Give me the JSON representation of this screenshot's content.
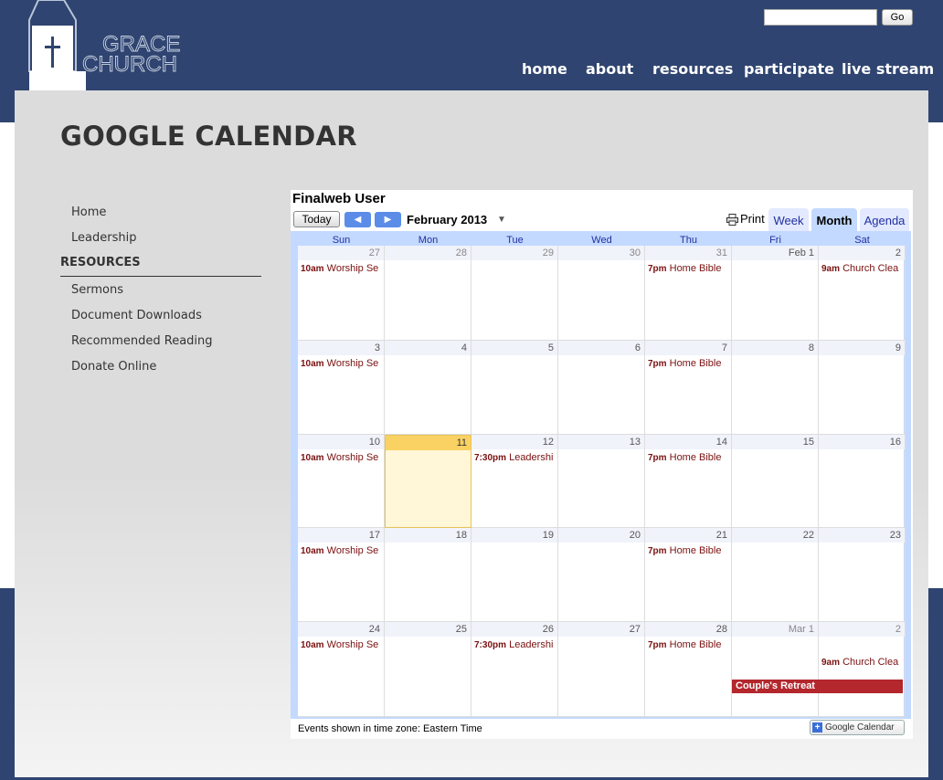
{
  "header": {
    "logo_text_line1": "GRACE",
    "logo_text_line2": "CHURCH",
    "search_placeholder": "",
    "go_label": "Go",
    "nav": [
      "home",
      "about",
      "resources",
      "participate",
      "live stream"
    ]
  },
  "page": {
    "title": "GOOGLE CALENDAR"
  },
  "sidebar": {
    "links_top": [
      "Home",
      "Leadership"
    ],
    "section_heading": "RESOURCES",
    "links": [
      "Sermons",
      "Document Downloads",
      "Recommended Reading",
      "Donate Online"
    ]
  },
  "calendar": {
    "owner": "Finalweb User",
    "today_label": "Today",
    "prev_icon": "◀",
    "next_icon": "▶",
    "month_label": "February 2013",
    "month_caret": "▼",
    "print_label": "Print",
    "tabs": [
      "Week",
      "Month",
      "Agenda"
    ],
    "active_tab": "Month",
    "days_of_week": [
      "Sun",
      "Mon",
      "Tue",
      "Wed",
      "Thu",
      "Fri",
      "Sat"
    ],
    "weeks": [
      [
        {
          "label": "27",
          "other": true,
          "events": [
            {
              "time": "10am",
              "title": "Worship Se"
            }
          ]
        },
        {
          "label": "28",
          "other": true,
          "events": []
        },
        {
          "label": "29",
          "other": true,
          "events": []
        },
        {
          "label": "30",
          "other": true,
          "events": []
        },
        {
          "label": "31",
          "other": true,
          "events": [
            {
              "time": "7pm",
              "title": "Home Bible"
            }
          ]
        },
        {
          "label": "Feb 1",
          "other": false,
          "events": []
        },
        {
          "label": "2",
          "other": false,
          "events": [
            {
              "time": "9am",
              "title": "Church Clea"
            }
          ]
        }
      ],
      [
        {
          "label": "3",
          "other": false,
          "events": [
            {
              "time": "10am",
              "title": "Worship Se"
            }
          ]
        },
        {
          "label": "4",
          "other": false,
          "events": []
        },
        {
          "label": "5",
          "other": false,
          "events": []
        },
        {
          "label": "6",
          "other": false,
          "events": []
        },
        {
          "label": "7",
          "other": false,
          "events": [
            {
              "time": "7pm",
              "title": "Home Bible"
            }
          ]
        },
        {
          "label": "8",
          "other": false,
          "events": []
        },
        {
          "label": "9",
          "other": false,
          "events": []
        }
      ],
      [
        {
          "label": "10",
          "other": false,
          "events": [
            {
              "time": "10am",
              "title": "Worship Se"
            }
          ]
        },
        {
          "label": "11",
          "other": false,
          "today": true,
          "events": []
        },
        {
          "label": "12",
          "other": false,
          "events": [
            {
              "time": "7:30pm",
              "title": "Leadershi"
            }
          ]
        },
        {
          "label": "13",
          "other": false,
          "events": []
        },
        {
          "label": "14",
          "other": false,
          "events": [
            {
              "time": "7pm",
              "title": "Home Bible"
            }
          ]
        },
        {
          "label": "15",
          "other": false,
          "events": []
        },
        {
          "label": "16",
          "other": false,
          "events": []
        }
      ],
      [
        {
          "label": "17",
          "other": false,
          "events": [
            {
              "time": "10am",
              "title": "Worship Se"
            }
          ]
        },
        {
          "label": "18",
          "other": false,
          "events": []
        },
        {
          "label": "19",
          "other": false,
          "events": []
        },
        {
          "label": "20",
          "other": false,
          "events": []
        },
        {
          "label": "21",
          "other": false,
          "events": [
            {
              "time": "7pm",
              "title": "Home Bible"
            }
          ]
        },
        {
          "label": "22",
          "other": false,
          "events": []
        },
        {
          "label": "23",
          "other": false,
          "events": []
        }
      ],
      [
        {
          "label": "24",
          "other": false,
          "events": [
            {
              "time": "10am",
              "title": "Worship Se"
            }
          ]
        },
        {
          "label": "25",
          "other": false,
          "events": []
        },
        {
          "label": "26",
          "other": false,
          "events": [
            {
              "time": "7:30pm",
              "title": "Leadershi"
            }
          ]
        },
        {
          "label": "27",
          "other": false,
          "events": []
        },
        {
          "label": "28",
          "other": false,
          "events": [
            {
              "time": "7pm",
              "title": "Home Bible"
            }
          ]
        },
        {
          "label": "Mar 1",
          "other": true,
          "events": []
        },
        {
          "label": "2",
          "other": true,
          "events": [
            {
              "time": "9am",
              "title": "Church Clea"
            }
          ]
        }
      ]
    ],
    "allday_event": "Couple's Retreat",
    "timezone_note": "Events shown in time zone: Eastern Time",
    "gcal_button_label": "Google Calendar",
    "colors": {
      "event": "#7a1010",
      "allday": "#b3272d",
      "today": "#fad163",
      "header_blue": "#2f4470"
    }
  }
}
